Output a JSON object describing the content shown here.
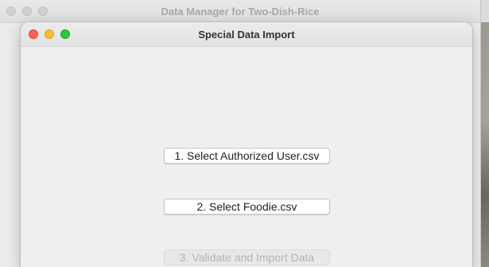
{
  "background_window": {
    "title": "Data Manager for Two-Dish-Rice"
  },
  "dialog": {
    "title": "Special Data Import",
    "buttons": [
      {
        "label": "1. Select Authorized User.csv",
        "enabled": true
      },
      {
        "label": "2. Select Foodie.csv",
        "enabled": true
      },
      {
        "label": "3. Validate and Import Data",
        "enabled": false
      }
    ]
  },
  "colors": {
    "close": "#fe5f57",
    "minimize": "#febc2e",
    "maximize": "#28c840",
    "disabled_text": "#b3b3b3"
  }
}
